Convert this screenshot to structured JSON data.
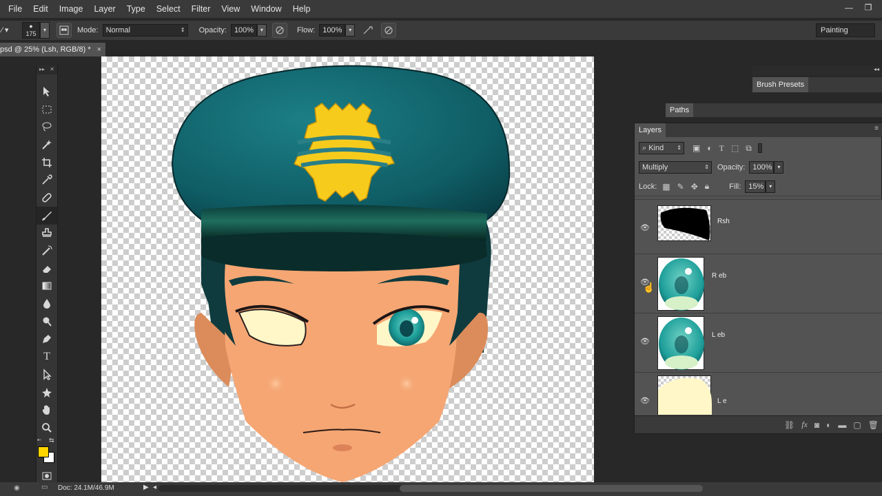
{
  "menu": [
    "File",
    "Edit",
    "Image",
    "Layer",
    "Type",
    "Select",
    "Filter",
    "View",
    "Window",
    "Help"
  ],
  "options": {
    "brush_size": "175",
    "mode_label": "Mode:",
    "mode_value": "Normal",
    "opacity_label": "Opacity:",
    "opacity_value": "100%",
    "flow_label": "Flow:",
    "flow_value": "100%",
    "workspace": "Painting"
  },
  "document": {
    "tab_title": "psd @ 25% (Lsh, RGB/8) *",
    "tab_close": "×",
    "status": "Doc: 24.1M/46.9M"
  },
  "colors": {
    "foreground": "#ffd500",
    "background": "#ffffff",
    "hat": "#136a72",
    "skin": "#f5a673",
    "eye_teal": "#1e9f9a",
    "badge": "#f7cb1c"
  },
  "panels": {
    "brush_presets": "Brush Presets",
    "paths": "Paths",
    "layers": "Layers"
  },
  "layers_panel": {
    "kind_label": "Kind",
    "blend_mode": "Multiply",
    "opacity_label": "Opacity:",
    "opacity_value": "100%",
    "lock_label": "Lock:",
    "fill_label": "Fill:",
    "fill_value": "15%",
    "layers": [
      {
        "name": "Rsh",
        "visible": true
      },
      {
        "name": "R eb",
        "visible": true
      },
      {
        "name": "L eb",
        "visible": true
      },
      {
        "name": "L e",
        "visible": true
      }
    ]
  },
  "tools": [
    "move-tool",
    "marquee-tool",
    "lasso-tool",
    "quick-select-tool",
    "crop-tool",
    "eyedropper-tool",
    "healing-tool",
    "brush-tool",
    "stamp-tool",
    "history-brush-tool",
    "eraser-tool",
    "gradient-tool",
    "blur-tool",
    "dodge-tool",
    "pen-tool",
    "type-tool",
    "path-select-tool",
    "shape-tool",
    "hand-tool",
    "zoom-tool"
  ],
  "active_tool": "brush-tool"
}
